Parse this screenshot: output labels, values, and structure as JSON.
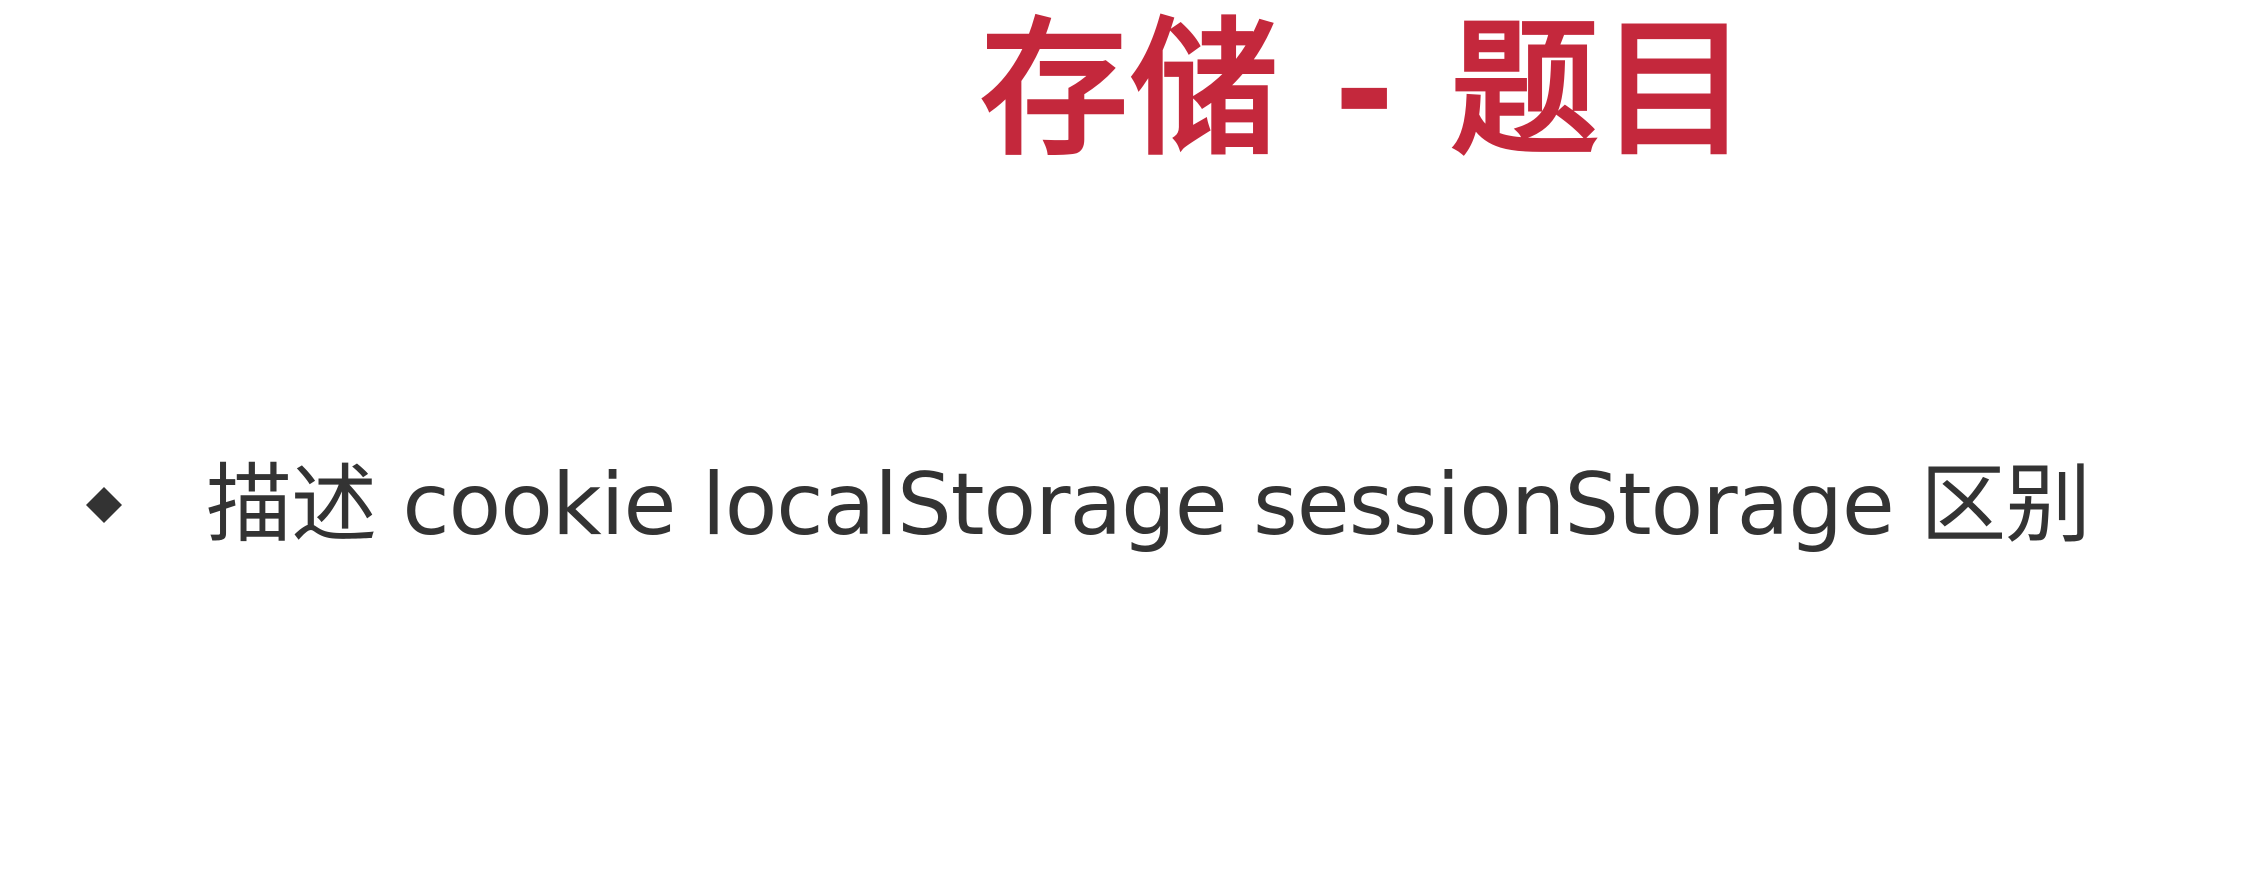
{
  "slide": {
    "title": "存储 - 题目",
    "bullets": [
      {
        "text": "描述 cookie localStorage sessionStorage 区别",
        "icon": "diamond-bullet-icon"
      }
    ]
  },
  "colors": {
    "title": "#c4283c",
    "text": "#333333",
    "background": "#ffffff"
  }
}
